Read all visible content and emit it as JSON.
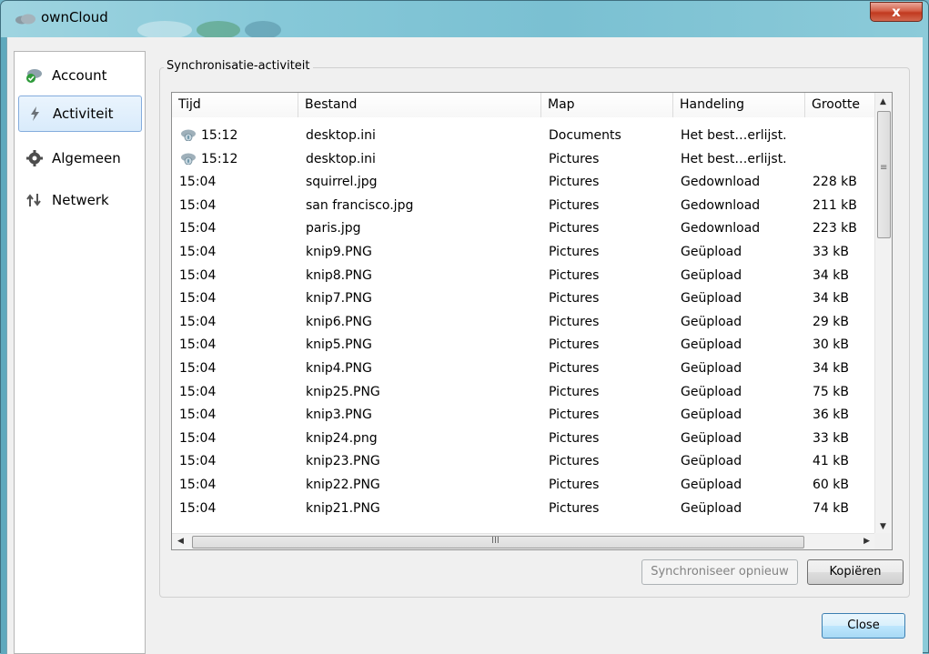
{
  "window": {
    "title": "ownCloud",
    "close_label": "x"
  },
  "sidebar": {
    "items": [
      {
        "label": "Account",
        "icon": "account-cloud-icon",
        "active": false
      },
      {
        "label": "Activiteit",
        "icon": "activity-bolt-icon",
        "active": true
      },
      {
        "label": "Algemeen",
        "icon": "gear-icon",
        "active": false
      },
      {
        "label": "Netwerk",
        "icon": "network-arrows-icon",
        "active": false
      }
    ]
  },
  "group": {
    "title": "Synchronisatie-activiteit"
  },
  "table": {
    "columns": [
      "Tijd",
      "Bestand",
      "Map",
      "Handeling",
      "Grootte"
    ],
    "rows": [
      {
        "time": "15:12",
        "icon": true,
        "file": "desktop.ini",
        "folder": "Documents",
        "action": "Het best…erlijst.",
        "size": ""
      },
      {
        "time": "15:12",
        "icon": true,
        "file": "desktop.ini",
        "folder": "Pictures",
        "action": "Het best…erlijst.",
        "size": ""
      },
      {
        "time": "15:04",
        "icon": false,
        "file": "squirrel.jpg",
        "folder": "Pictures",
        "action": "Gedownload",
        "size": "228 kB"
      },
      {
        "time": "15:04",
        "icon": false,
        "file": "san francisco.jpg",
        "folder": "Pictures",
        "action": "Gedownload",
        "size": "211 kB"
      },
      {
        "time": "15:04",
        "icon": false,
        "file": "paris.jpg",
        "folder": "Pictures",
        "action": "Gedownload",
        "size": "223 kB"
      },
      {
        "time": "15:04",
        "icon": false,
        "file": "knip9.PNG",
        "folder": "Pictures",
        "action": "Geüpload",
        "size": "33 kB"
      },
      {
        "time": "15:04",
        "icon": false,
        "file": "knip8.PNG",
        "folder": "Pictures",
        "action": "Geüpload",
        "size": "34 kB"
      },
      {
        "time": "15:04",
        "icon": false,
        "file": "knip7.PNG",
        "folder": "Pictures",
        "action": "Geüpload",
        "size": "34 kB"
      },
      {
        "time": "15:04",
        "icon": false,
        "file": "knip6.PNG",
        "folder": "Pictures",
        "action": "Geüpload",
        "size": "29 kB"
      },
      {
        "time": "15:04",
        "icon": false,
        "file": "knip5.PNG",
        "folder": "Pictures",
        "action": "Geüpload",
        "size": "30 kB"
      },
      {
        "time": "15:04",
        "icon": false,
        "file": "knip4.PNG",
        "folder": "Pictures",
        "action": "Geüpload",
        "size": "34 kB"
      },
      {
        "time": "15:04",
        "icon": false,
        "file": "knip25.PNG",
        "folder": "Pictures",
        "action": "Geüpload",
        "size": "75 kB"
      },
      {
        "time": "15:04",
        "icon": false,
        "file": "knip3.PNG",
        "folder": "Pictures",
        "action": "Geüpload",
        "size": "36 kB"
      },
      {
        "time": "15:04",
        "icon": false,
        "file": "knip24.png",
        "folder": "Pictures",
        "action": "Geüpload",
        "size": "33 kB"
      },
      {
        "time": "15:04",
        "icon": false,
        "file": "knip23.PNG",
        "folder": "Pictures",
        "action": "Geüpload",
        "size": "41 kB"
      },
      {
        "time": "15:04",
        "icon": false,
        "file": "knip22.PNG",
        "folder": "Pictures",
        "action": "Geüpload",
        "size": "60 kB"
      },
      {
        "time": "15:04",
        "icon": false,
        "file": "knip21.PNG",
        "folder": "Pictures",
        "action": "Geüpload",
        "size": "74 kB"
      }
    ],
    "scroll_grip": "≡",
    "hscroll_grip": "III"
  },
  "buttons": {
    "resync": "Synchroniseer opnieuw",
    "copy": "Kopiëren",
    "close": "Close"
  },
  "colors": {
    "accent": "#3c7fb1",
    "selection_border": "#84acdd"
  }
}
